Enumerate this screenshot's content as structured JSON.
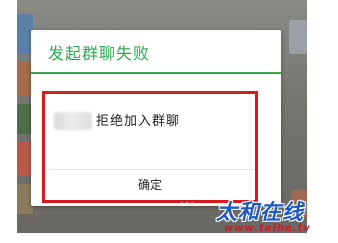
{
  "dialog": {
    "title": "发起群聊失败",
    "message": "拒绝加入群聊",
    "confirm_label": "确定"
  },
  "watermark": {
    "faint_text": "。。。",
    "brand_cn": "太和在线",
    "brand_url": "www.taihe.tv"
  },
  "colors": {
    "title_green": "#2fa84f",
    "highlight_red": "#d61a1f",
    "watermark_blue": "#1d57c4"
  }
}
